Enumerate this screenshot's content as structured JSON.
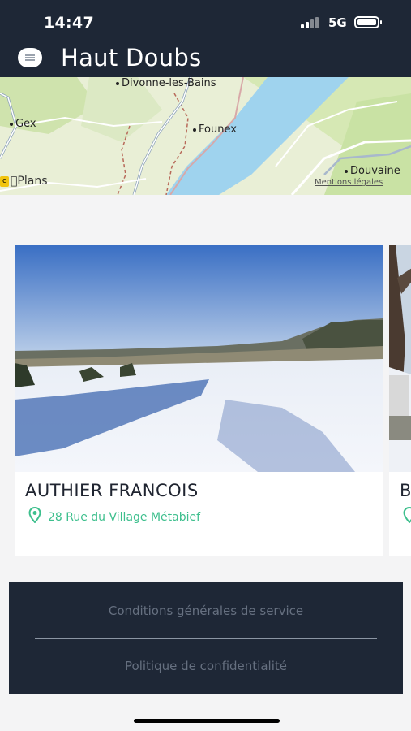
{
  "status_bar": {
    "time": "14:47",
    "network": "5G"
  },
  "header": {
    "title": "Haut Doubs",
    "menu_icon": "menu-icon"
  },
  "map": {
    "labels": [
      "Divonne-les-Bains",
      "Gex",
      "Founex",
      "Douvaine"
    ],
    "attribution": "Plans",
    "legal": "Mentions légales",
    "colors": {
      "land": "#e9efd6",
      "water": "#9fd3ee",
      "park": "#c9e2a4"
    }
  },
  "cards": [
    {
      "name": "AUTHIER FRANCOIS",
      "address": "28 Rue du Village Métabief",
      "pin_icon": "location-pin-icon"
    },
    {
      "name": "B",
      "pin_icon": "location-pin-icon"
    }
  ],
  "footer": {
    "terms": "Conditions générales de service",
    "privacy": "Politique de confidentialité"
  },
  "colors": {
    "header_bg": "#1e2736",
    "accent": "#3dbf8d",
    "page_bg": "#f4f4f5"
  }
}
